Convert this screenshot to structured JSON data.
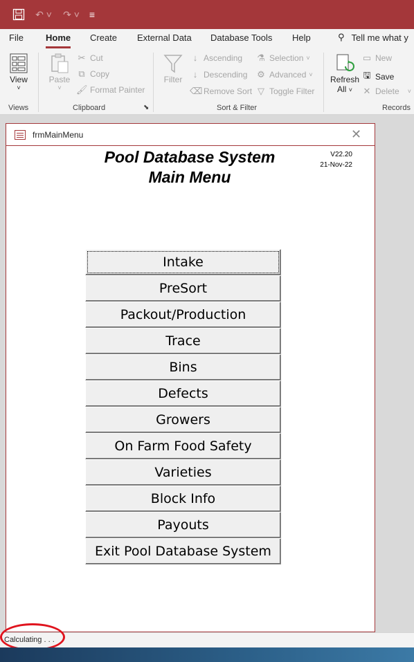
{
  "qat": {
    "save_icon": "save-icon",
    "undo_icon": "undo-icon",
    "redo_icon": "redo-icon",
    "customize_icon": "customize-icon"
  },
  "tabs": [
    "File",
    "Home",
    "Create",
    "External Data",
    "Database Tools",
    "Help"
  ],
  "active_tab": "Home",
  "tell_me": "Tell me what y",
  "ribbon": {
    "views": {
      "view_label": "View",
      "group": "Views"
    },
    "clipboard": {
      "paste": "Paste",
      "cut": "Cut",
      "copy": "Copy",
      "format_painter": "Format Painter",
      "group": "Clipboard"
    },
    "sort_filter": {
      "filter": "Filter",
      "ascending": "Ascending",
      "descending": "Descending",
      "remove_sort": "Remove Sort",
      "selection": "Selection",
      "advanced": "Advanced",
      "toggle_filter": "Toggle Filter",
      "group": "Sort & Filter"
    },
    "records": {
      "refresh": "Refresh",
      "refresh_all": "All",
      "new": "New",
      "save": "Save",
      "delete": "Delete",
      "group": "Records"
    }
  },
  "form": {
    "name": "frmMainMenu",
    "title_line1": "Pool Database System",
    "title_line2": "Main Menu",
    "version": "V22.20",
    "date": "21-Nov-22"
  },
  "menu_buttons": [
    "Intake",
    "PreSort",
    "Packout/Production",
    "Trace",
    "Bins",
    "Defects",
    "Growers",
    "On Farm Food Safety",
    "Varieties",
    "Block Info",
    "Payouts",
    "Exit Pool Database System"
  ],
  "status": {
    "text": "Calculating . . ."
  },
  "colors": {
    "accent": "#a4373a",
    "annotation_ring": "#e0141e"
  }
}
